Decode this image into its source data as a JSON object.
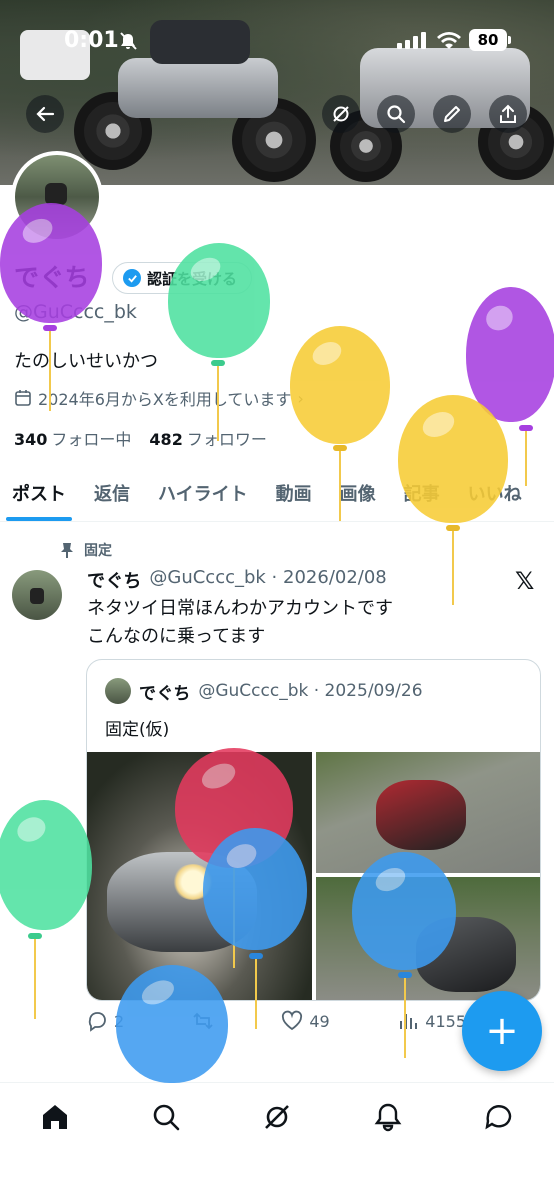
{
  "status_bar": {
    "time": "0:01",
    "battery": "80"
  },
  "profile": {
    "name": "でぐち",
    "verify_button": "認証を受ける",
    "handle": "@GuCccc_bk",
    "bio": "たのしいせいかつ",
    "joined": "2024年6月からXを利用しています",
    "following_count": "340",
    "following_label": "フォロー中",
    "followers_count": "482",
    "followers_label": "フォロワー"
  },
  "tabs": [
    "ポスト",
    "返信",
    "ハイライト",
    "動画",
    "画像",
    "記事",
    "いいね"
  ],
  "post": {
    "pinned_label": "固定",
    "name": "でぐち",
    "meta": "@GuCccc_bk · 2026/02/08",
    "text_line1": "ネタツイ日常ほんわかアカウントです",
    "text_line2": "こんなのに乗ってます",
    "quote": {
      "name": "でぐち",
      "meta": "@GuCccc_bk · 2025/09/26",
      "text": "固定(仮)"
    },
    "actions": {
      "replies": "2",
      "likes": "49",
      "views": "4155"
    }
  },
  "colors": {
    "accent": "#1d9bf0",
    "text": "#0f1419",
    "muted": "#536471"
  }
}
